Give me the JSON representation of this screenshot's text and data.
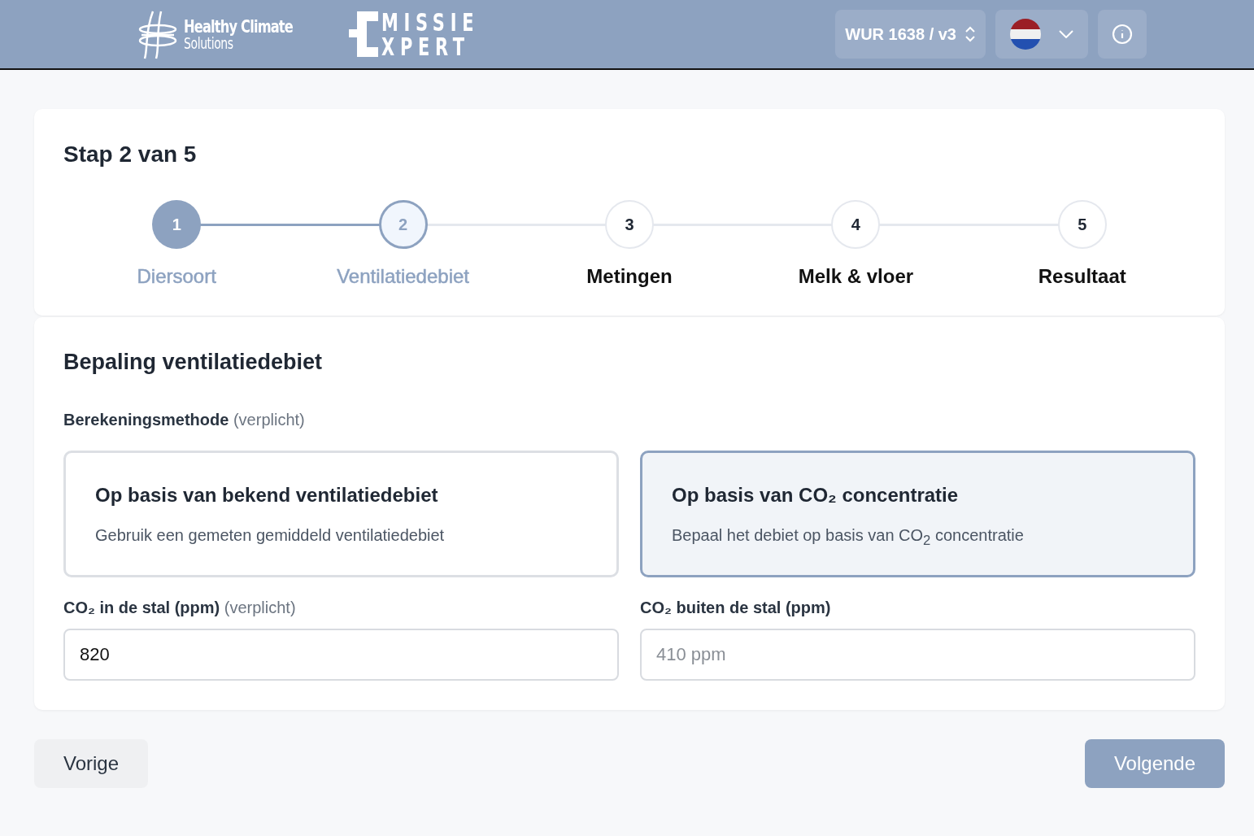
{
  "header": {
    "brand": {
      "line1": "Healthy Climate",
      "line2": "Solutions"
    },
    "logo": {
      "line1": "MISSIE",
      "line2": "XPERT"
    },
    "project_select": "WUR 1638 / v3"
  },
  "wizard": {
    "title": "Stap 2 van 5",
    "steps": [
      {
        "number": "1",
        "label": "Diersoort",
        "completed": true,
        "selected": false
      },
      {
        "number": "2",
        "label": "Ventilatiedebiet",
        "completed": false,
        "selected": true
      },
      {
        "number": "3",
        "label": "Metingen",
        "completed": false,
        "selected": false
      },
      {
        "number": "4",
        "label": "Melk & vloer",
        "completed": false,
        "selected": false
      },
      {
        "number": "5",
        "label": "Resultaat",
        "completed": false,
        "selected": false
      }
    ]
  },
  "form": {
    "title": "Bepaling ventilatiedebiet",
    "method_label": "Berekeningsmethode",
    "method_note": "(verplicht)",
    "options": [
      {
        "title": "Op basis van bekend ventilatiedebiet",
        "description": "Gebruik een gemeten gemiddeld ventilatiedebiet",
        "selected": false
      },
      {
        "title": "Op basis van CO₂ concentratie",
        "description": "Bepaal het debiet op basis van CO$_{2}$ concentratie",
        "selected": true
      }
    ],
    "fields": [
      {
        "label": "CO₂ in de stal (ppm)",
        "note": "(verplicht)",
        "value": "820"
      },
      {
        "label": "CO₂ buiten de stal (ppm)",
        "placeholder": "410 ppm"
      }
    ]
  },
  "buttons": {
    "back": "Vorige",
    "next": "Volgende"
  }
}
